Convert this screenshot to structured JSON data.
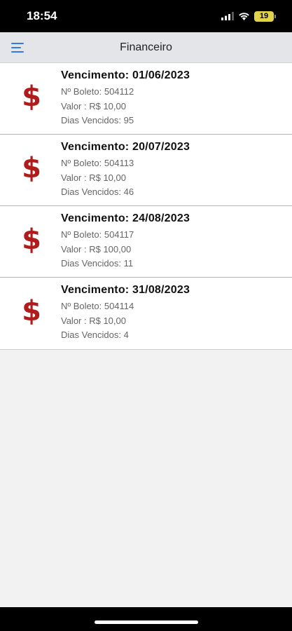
{
  "status_bar": {
    "time": "18:54",
    "battery": "19",
    "signal_icon": "cellular-signal-icon",
    "wifi_icon": "wifi-icon"
  },
  "header": {
    "title": "Financeiro",
    "menu_icon": "hamburger-menu-icon",
    "accent_color": "#2f7de1"
  },
  "boletos": [
    {
      "vencimento": "Vencimento: 01/06/2023",
      "boleto": "Nº Boleto: 504112",
      "valor": "Valor : R$ 10,00",
      "dias": "Dias Vencidos: 95",
      "icon": "dollar-sign-icon"
    },
    {
      "vencimento": "Vencimento: 20/07/2023",
      "boleto": "Nº Boleto: 504113",
      "valor": "Valor : R$ 10,00",
      "dias": "Dias Vencidos: 46",
      "icon": "dollar-sign-icon"
    },
    {
      "vencimento": "Vencimento: 24/08/2023",
      "boleto": "Nº Boleto: 504117",
      "valor": "Valor : R$ 100,00",
      "dias": "Dias Vencidos: 11",
      "icon": "dollar-sign-icon"
    },
    {
      "vencimento": "Vencimento: 31/08/2023",
      "boleto": "Nº Boleto: 504114",
      "valor": "Valor : R$ 10,00",
      "dias": "Dias Vencidos: 4",
      "icon": "dollar-sign-icon"
    }
  ],
  "colors": {
    "dollar_icon": "#b01c1c",
    "divider": "#d9a3a7",
    "battery": "#e0d34a"
  }
}
